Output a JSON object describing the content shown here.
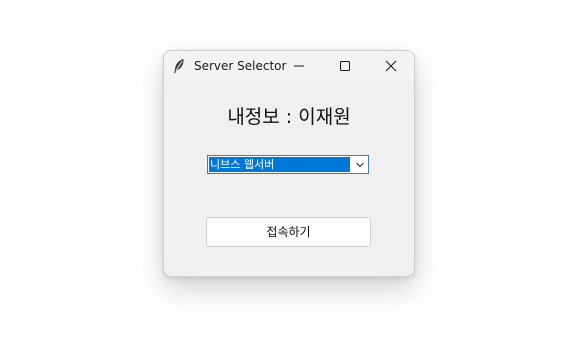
{
  "window": {
    "title": "Server Selector",
    "icon": "feather-icon",
    "controls": {
      "minimize_icon": "minimize-icon",
      "maximize_icon": "maximize-icon",
      "close_icon": "close-icon"
    }
  },
  "main": {
    "info_label": "내정보 : 이재원",
    "server_select": {
      "selected_value": "니브스 웹서버",
      "dropdown_icon": "chevron-down-icon"
    },
    "connect_button_label": "접속하기"
  },
  "colors": {
    "selection_bg": "#0078d7",
    "window_bg": "#f0f0f0",
    "combo_border": "#3c7fb1"
  }
}
